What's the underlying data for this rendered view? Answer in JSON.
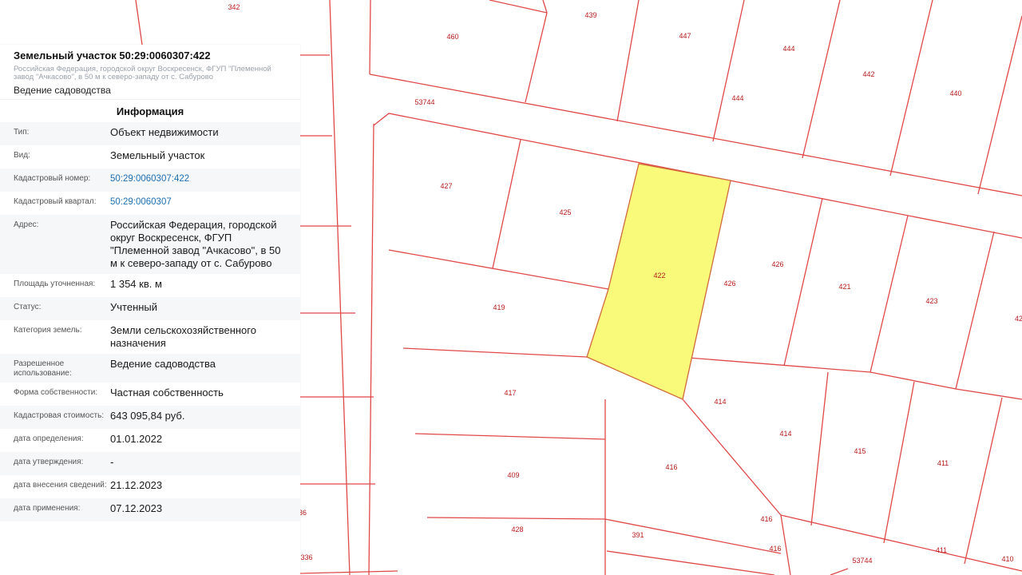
{
  "map": {
    "selected_color": "#f9fa7a",
    "line_color": "#e04848",
    "plot_labels": [
      "342",
      "439",
      "460",
      "447",
      "444",
      "442",
      "440",
      "53744",
      "444",
      "427",
      "425",
      "422",
      "426",
      "426",
      "421",
      "423",
      "42",
      "419",
      "417",
      "414",
      "414",
      "415",
      "411",
      "409",
      "416",
      "416",
      "428",
      "391",
      "416",
      "411",
      "410",
      "53744",
      "36",
      "336"
    ]
  },
  "panel": {
    "title": "Земельный участок 50:29:0060307:422",
    "address_short": "Российская Федерация, городской округ Воскресенск, ФГУП \"Племенной завод \"Ачкасово\", в 50 м к северо-западу от с. Сабурово",
    "permitted_use": "Ведение садоводства",
    "section_title": "Информация",
    "rows": [
      {
        "label": "Тип:",
        "value": "Объект недвижимости"
      },
      {
        "label": "Вид:",
        "value": "Земельный участок"
      },
      {
        "label": "Кадастровый номер:",
        "value": "50:29:0060307:422",
        "link": true
      },
      {
        "label": "Кадастровый квартал:",
        "value": "50:29:0060307",
        "link": true
      },
      {
        "label": "Адрес:",
        "value": "Российская Федерация, городской округ Воскресенск, ФГУП \"Племенной завод \"Ачкасово\", в 50 м к северо-западу от с. Сабурово"
      },
      {
        "label": "Площадь уточненная:",
        "value": "1 354 кв. м"
      },
      {
        "label": "Статус:",
        "value": "Учтенный"
      },
      {
        "label": "Категория земель:",
        "value": "Земли сельскохозяйственного назначения"
      },
      {
        "label": "Разрешенное использование:",
        "value": "Ведение садоводства"
      },
      {
        "label": "Форма собственности:",
        "value": "Частная собственность"
      },
      {
        "label": "Кадастровая стоимость:",
        "value": "643 095,84 руб."
      },
      {
        "label": "дата определения:",
        "value": "01.01.2022"
      },
      {
        "label": "дата утверждения:",
        "value": "-"
      },
      {
        "label": "дата внесения сведений:",
        "value": "21.12.2023"
      },
      {
        "label": "дата применения:",
        "value": "07.12.2023"
      }
    ]
  }
}
